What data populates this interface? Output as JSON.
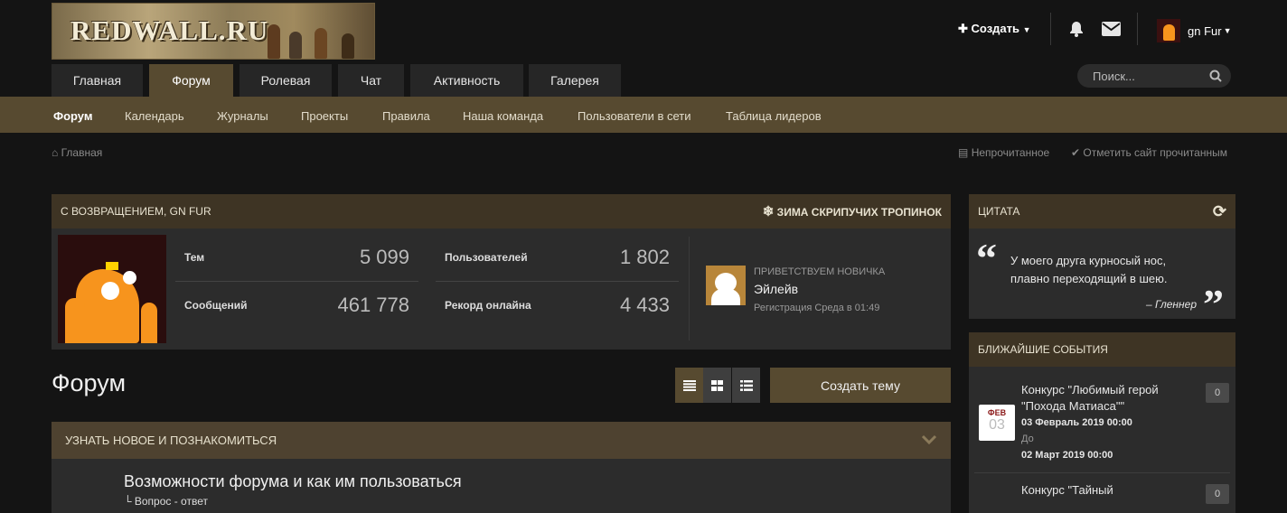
{
  "header": {
    "logo_text": "REDWALL.RU",
    "create_label": "Создать",
    "username": "gn Fur"
  },
  "tabs": [
    {
      "label": "Главная",
      "selected": false
    },
    {
      "label": "Форум",
      "selected": true
    },
    {
      "label": "Ролевая",
      "selected": false
    },
    {
      "label": "Чат",
      "selected": false
    },
    {
      "label": "Активность",
      "selected": false
    },
    {
      "label": "Галерея",
      "selected": false
    }
  ],
  "search": {
    "placeholder": "Поиск..."
  },
  "subnav": [
    "Форум",
    "Календарь",
    "Журналы",
    "Проекты",
    "Правила",
    "Наша команда",
    "Пользователи в сети",
    "Таблица лидеров"
  ],
  "breadcrumb": {
    "home": "Главная"
  },
  "links": {
    "unread": "Непрочитанное",
    "mark_read": "Отметить сайт прочитанным"
  },
  "welcome": {
    "title": "С ВОЗВРАЩЕНИЕМ, GN FUR",
    "theme": "ЗИМА СКРИПУЧИХ ТРОПИНОК",
    "stats": {
      "topics_label": "Тем",
      "topics": "5 099",
      "users_label": "Пользователей",
      "users": "1 802",
      "posts_label": "Сообщений",
      "posts": "461 778",
      "record_label": "Рекорд онлайна",
      "record": "4 433"
    },
    "newcomer": {
      "heading": "ПРИВЕТСТВУЕМ НОВИЧКА",
      "name": "Эйлейв",
      "registered": "Регистрация Среда в 01:49"
    }
  },
  "quote": {
    "title": "ЦИТАТА",
    "text_line1": "У моего друга курносый нос,",
    "text_line2": "плавно переходящий в шею.",
    "author": "– Гленнер"
  },
  "events": {
    "title": "БЛИЖАЙШИЕ СОБЫТИЯ",
    "items": [
      {
        "line1": "Конкурс \"Любимый герой",
        "line2": "\"Похода Матиаса\"\"",
        "month": "ФЕВ",
        "day": "03",
        "start": "03 Февраль 2019 00:00",
        "until": "До",
        "end": "02 Март 2019 00:00",
        "count": "0"
      },
      {
        "line1": "Конкурс \"Тайный",
        "count": "0"
      }
    ]
  },
  "forum": {
    "title": "Форум",
    "new_topic": "Создать тему",
    "category": "УЗНАТЬ НОВОЕ И ПОЗНАКОМИТЬСЯ",
    "node_title": "Возможности форума и как им пользоваться",
    "node_sub": "Вопрос - ответ"
  },
  "colors": {
    "accent": "#574a30",
    "panel": "#2c2c2c",
    "background": "#141414"
  }
}
